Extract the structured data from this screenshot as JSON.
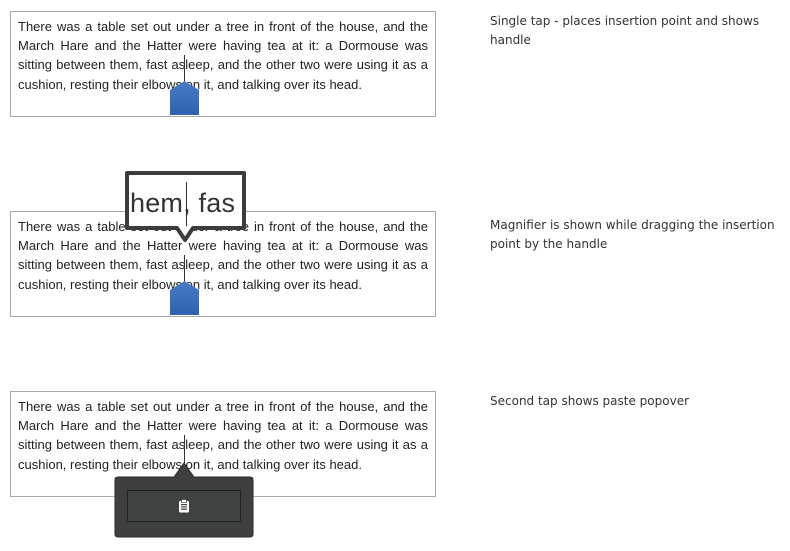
{
  "passage": "There was a table set out under a tree in front of the house, and the March Hare and the Hatter were having tea at it: a Dormouse was sitting between them, fast asleep, and the other two were using it as a cushion, resting their elbows on it, and talking over its head.",
  "panels": [
    {
      "caption": "Single tap - places insertion point and shows handle"
    },
    {
      "caption": "Magnifier is shown while dragging the insertion point by the handle",
      "magnifier_text": "hem, fas"
    },
    {
      "caption": "Second tap shows paste popover",
      "popover_icon": "clipboard-paste-icon"
    }
  ],
  "colors": {
    "handle": "#3366b3",
    "popover": "#3d403f",
    "border": "#a9a9a9"
  }
}
